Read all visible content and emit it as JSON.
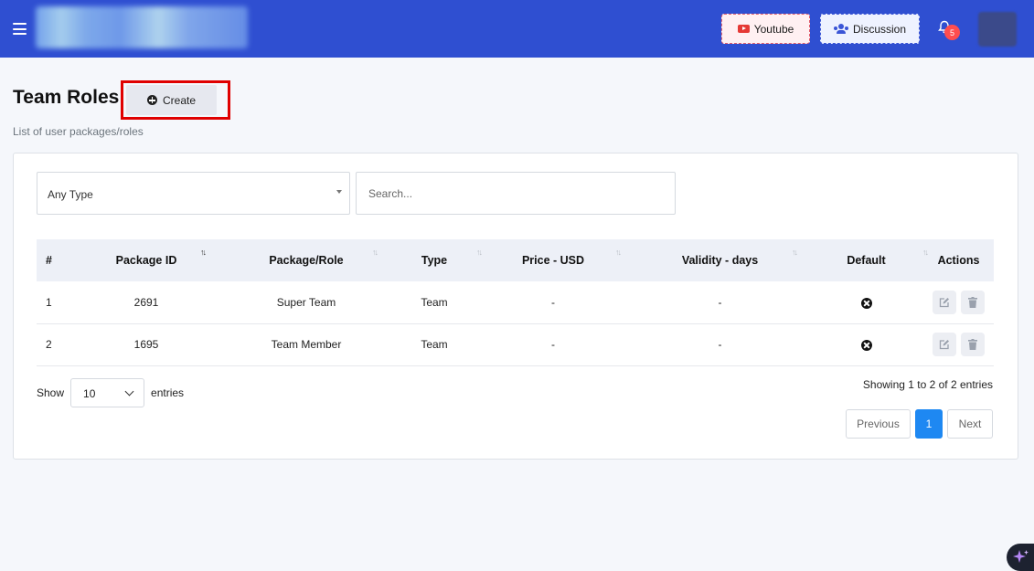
{
  "topbar": {
    "youtube_label": "Youtube",
    "discussion_label": "Discussion",
    "notification_count": "5"
  },
  "page": {
    "title": "Team Roles",
    "create_label": "Create",
    "subtitle": "List of user packages/roles"
  },
  "filters": {
    "type_selected": "Any Type",
    "search_placeholder": "Search..."
  },
  "table": {
    "columns": [
      "#",
      "Package ID",
      "Package/Role",
      "Type",
      "Price - USD",
      "Validity - days",
      "Default",
      "Actions"
    ],
    "rows": [
      {
        "num": "1",
        "package_id": "2691",
        "role": "Super Team",
        "type": "Team",
        "price": "-",
        "validity": "-"
      },
      {
        "num": "2",
        "package_id": "1695",
        "role": "Team Member",
        "type": "Team",
        "price": "-",
        "validity": "-"
      }
    ]
  },
  "footer": {
    "show_label": "Show",
    "page_length": "10",
    "entries_label": "entries",
    "info": "Showing 1 to 2 of 2 entries",
    "prev_label": "Previous",
    "current_page": "1",
    "next_label": "Next"
  },
  "colors": {
    "topbar": "#2f4fd1",
    "highlight": "#e00000",
    "active_page": "#1e88f2"
  }
}
